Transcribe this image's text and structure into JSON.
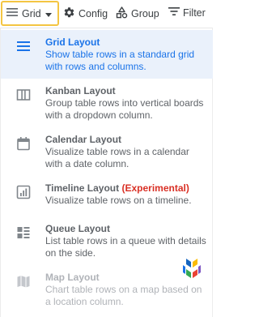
{
  "toolbar": {
    "view_label": "Grid",
    "config_label": "Config",
    "group_label": "Group",
    "filter_label": "Filter"
  },
  "menu": {
    "items": [
      {
        "title": "Grid Layout",
        "description": "Show table rows in a standard grid with rows and columns.",
        "icon": "grid-lines-icon",
        "selected": true
      },
      {
        "title": "Kanban Layout",
        "description": "Group table rows into vertical boards with a dropdown column.",
        "icon": "kanban-columns-icon"
      },
      {
        "title": "Calendar Layout",
        "description": "Visualize table rows in a calendar with a date column.",
        "icon": "calendar-icon"
      },
      {
        "title": "Timeline Layout",
        "badge": "(Experimental)",
        "description": "Visualize table rows on a timeline.",
        "icon": "timeline-chart-icon"
      },
      {
        "title": "Queue Layout",
        "description": "List table rows in a queue with details on the side.",
        "icon": "queue-list-icon"
      },
      {
        "title": "Map Layout",
        "description": "Chart table rows on a map based on a location column.",
        "icon": "map-icon",
        "disabled": true
      }
    ]
  },
  "colors": {
    "accent": "#1a73e8",
    "selected_bg": "#eaf1fb",
    "highlight_border": "#f4c542",
    "experimental": "#d93025",
    "muted": "#5f6368",
    "disabled": "#b0b3b8"
  }
}
